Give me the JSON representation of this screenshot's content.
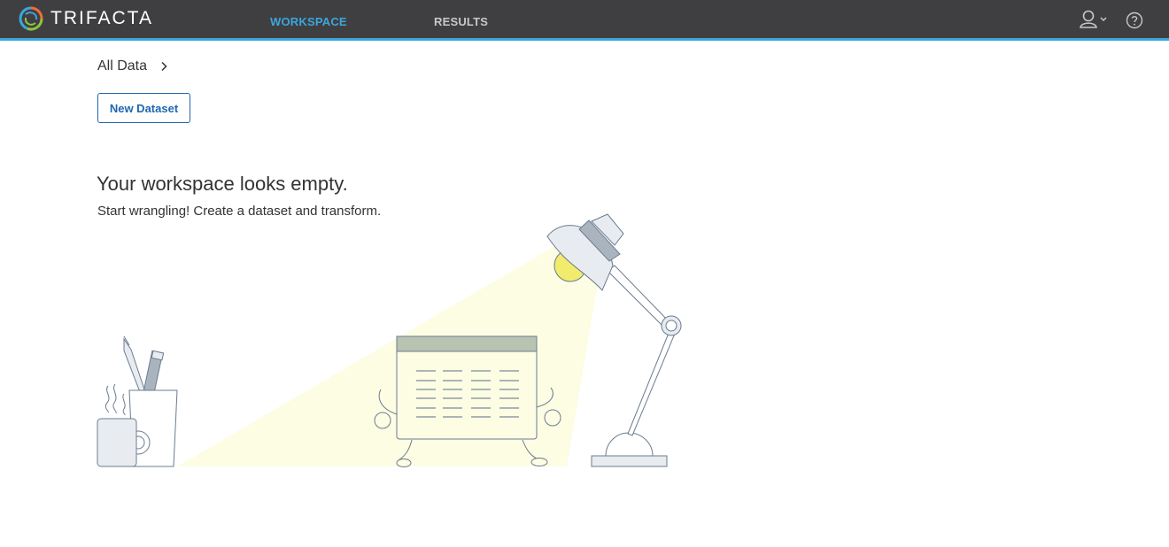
{
  "app": {
    "brand_name": "TRIFACTA",
    "accent_color": "#3ba6dc",
    "topbar_color": "#3f3f41"
  },
  "nav": {
    "tabs": [
      {
        "label": "WORKSPACE",
        "active": true
      },
      {
        "label": "RESULTS",
        "active": false
      }
    ]
  },
  "header_icons": {
    "user": "user-icon",
    "dropdown": "chevron-down-icon",
    "help": "help-icon"
  },
  "breadcrumb": {
    "label": "All Data",
    "icon": "chevron-right-icon"
  },
  "actions": {
    "new_dataset_label": "New Dataset"
  },
  "empty_state": {
    "title": "Your workspace looks empty.",
    "subtitle": "Start wrangling! Create a dataset and transform.",
    "illustration": "desk-lamp-dataset-illustration"
  }
}
